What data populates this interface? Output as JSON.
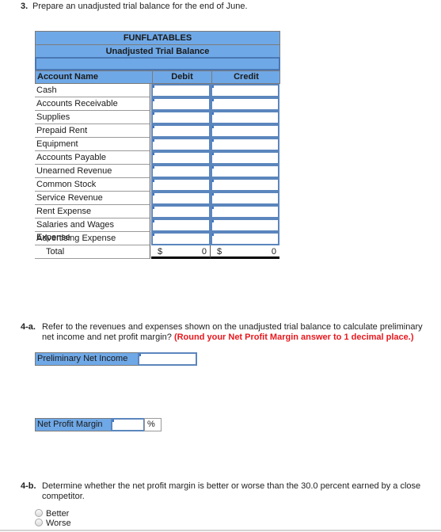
{
  "q3": {
    "number": "3.",
    "text": "Prepare an unadjusted trial balance for the end of June."
  },
  "trial_balance": {
    "company": "FUNFLATABLES",
    "title": "Unadjusted Trial Balance",
    "columns": {
      "account": "Account Name",
      "debit": "Debit",
      "credit": "Credit"
    },
    "accounts": [
      {
        "name": "Cash",
        "debit": "",
        "credit": ""
      },
      {
        "name": "Accounts Receivable",
        "debit": "",
        "credit": ""
      },
      {
        "name": "Supplies",
        "debit": "",
        "credit": ""
      },
      {
        "name": "Prepaid Rent",
        "debit": "",
        "credit": ""
      },
      {
        "name": "Equipment",
        "debit": "",
        "credit": ""
      },
      {
        "name": "Accounts Payable",
        "debit": "",
        "credit": ""
      },
      {
        "name": "Unearned Revenue",
        "debit": "",
        "credit": ""
      },
      {
        "name": "Common Stock",
        "debit": "",
        "credit": ""
      },
      {
        "name": "Service Revenue",
        "debit": "",
        "credit": ""
      },
      {
        "name": "Rent Expense",
        "debit": "",
        "credit": ""
      },
      {
        "name": "Salaries and Wages Expense",
        "debit": "",
        "credit": ""
      },
      {
        "name": "Advertising Expense",
        "debit": "",
        "credit": ""
      }
    ],
    "total": {
      "label": "Total",
      "debit_currency": "$",
      "debit_amount": "0",
      "credit_currency": "$",
      "credit_amount": "0"
    }
  },
  "q4a": {
    "number": "4-a.",
    "text_line1": "Refer to the revenues and expenses shown on the unadjusted trial balance to calculate preliminary",
    "text_line2": "net income and net profit margin?",
    "instruction": "(Round your Net Profit Margin answer to 1 decimal place.)",
    "net_income": {
      "label": "Preliminary Net Income",
      "value": ""
    },
    "profit_margin": {
      "label": "Net Profit Margin",
      "value": "",
      "unit": "%"
    }
  },
  "q4b": {
    "number": "4-b.",
    "text_line1": "Determine whether the net profit margin is better or worse than the 30.0 percent earned by a close",
    "text_line2": "competitor.",
    "options": [
      "Better",
      "Worse"
    ]
  }
}
